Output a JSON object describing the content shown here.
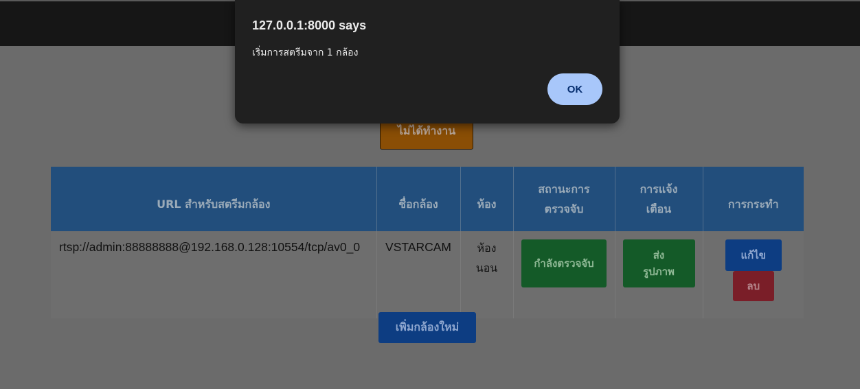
{
  "page": {
    "status_button_label": "ไม่ได้ทำงาน",
    "add_camera_label": "เพิ่มกล้องใหม่"
  },
  "table": {
    "headers": [
      "URL สำหรับสตรีมกล้อง",
      "ชื่อกล้อง",
      "ห้อง",
      "สถานะการตรวจจับ",
      "การแจ้งเตือน",
      "การกระทำ"
    ],
    "rows": [
      {
        "url": "rtsp://admin:88888888@192.168.0.128:10554/tcp/av0_0",
        "name": "VSTARCAM",
        "room": "ห้องนอน",
        "detection_button": "กำลังตรวจจับ",
        "notify_button": "ส่งรูปภาพ",
        "edit_button": "แก้ไข",
        "delete_button": "ลบ"
      }
    ]
  },
  "dialog": {
    "title": "127.0.0.1:8000 says",
    "message": "เริ่มการสตรีมจาก 1 กล้อง",
    "ok_label": "OK"
  },
  "colors": {
    "header_bg": "#224e7c",
    "detect_green": "#145a28",
    "primary_blue": "#0d3d82",
    "danger_red": "#7a1e28",
    "warning_orange": "#8a4e05",
    "dialog_bg": "#202020",
    "ok_button": "#a8c7fa"
  }
}
